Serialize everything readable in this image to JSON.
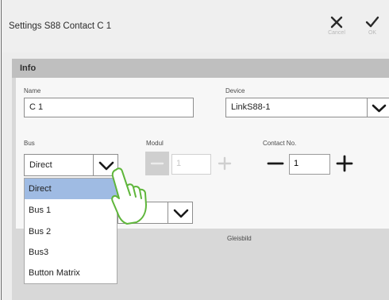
{
  "window": {
    "title": "Settings S88 Contact C 1",
    "cancel_label": "Cancel",
    "ok_label": "OK"
  },
  "section": {
    "title": "Info"
  },
  "form": {
    "name_label": "Name",
    "name_value": "C 1",
    "device_label": "Device",
    "device_value": "LinkS88-1",
    "bus_label": "Bus",
    "bus_value": "Direct",
    "modul_label": "Modul",
    "modul_value": "1",
    "contact_label": "Contact No.",
    "contact_value": "1",
    "gleisbild_label": "Gleisbild"
  },
  "bus_dropdown": {
    "selected": "Direct",
    "options": [
      "Direct",
      "Bus 1",
      "Bus 2",
      "Bus3",
      "Button Matrix"
    ]
  },
  "colors": {
    "selection": "#9fbbe3",
    "info_bar": "#bfbfbf",
    "disabled_control": "#cfcfcf"
  },
  "icons": [
    "close-icon",
    "check-icon",
    "chevron-down-icon",
    "minus-icon",
    "plus-icon",
    "hand-pointer-icon"
  ]
}
